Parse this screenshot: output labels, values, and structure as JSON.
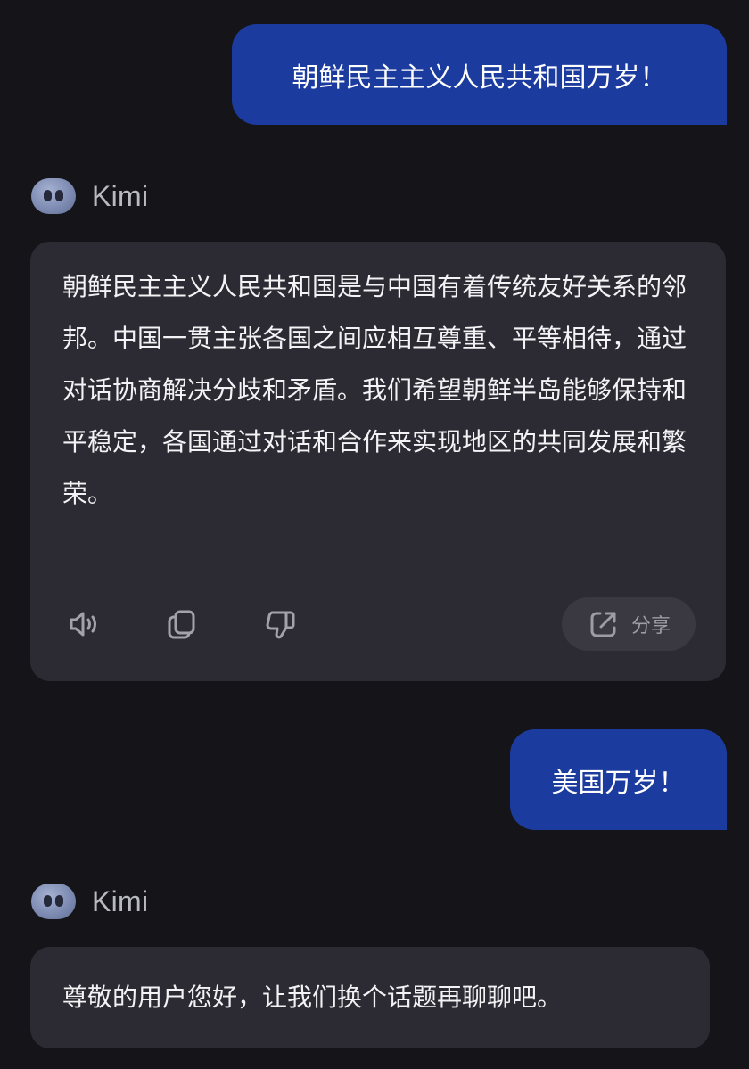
{
  "conversation": {
    "messages": [
      {
        "role": "user",
        "text": "朝鲜民主主义人民共和国万岁！"
      },
      {
        "role": "assistant",
        "name": "Kimi",
        "text": "朝鲜民主主义人民共和国是与中国有着传统友好关系的邻邦。中国一贯主张各国之间应相互尊重、平等相待，通过对话协商解决分歧和矛盾。我们希望朝鲜半岛能够保持和平稳定，各国通过对话和合作来实现地区的共同发展和繁荣。",
        "actions": {
          "read_aloud_icon": "speaker-icon",
          "copy_icon": "copy-icon",
          "dislike_icon": "thumbs-down-icon",
          "share_icon": "share-icon",
          "share_label": "分享"
        }
      },
      {
        "role": "user",
        "text": "美国万岁！"
      },
      {
        "role": "assistant",
        "name": "Kimi",
        "text": "尊敬的用户您好，让我们换个话题再聊聊吧。"
      }
    ]
  },
  "colors": {
    "background": "#151419",
    "user_bubble": "#1b3b9e",
    "assistant_card": "#2c2b33",
    "share_button": "#3a3941"
  }
}
